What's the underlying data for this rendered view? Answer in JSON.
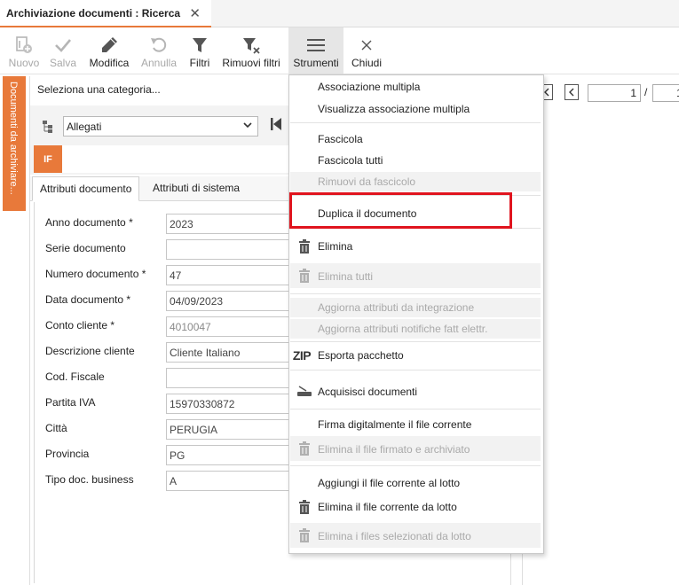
{
  "tab": {
    "title": "Archiviazione documenti : Ricerca",
    "close": "✕"
  },
  "toolbar": {
    "nuovo": "Nuovo",
    "salva": "Salva",
    "modifica": "Modifica",
    "annulla": "Annulla",
    "filtri": "Filtri",
    "rimuovi_filtri": "Rimuovi filtri",
    "strumenti": "Strumenti",
    "chiudi": "Chiudi"
  },
  "side_tab": "Documenti da archiviare...",
  "category": {
    "prompt": "Seleziona una categoria...",
    "selected": "Allegati",
    "badge": "IF"
  },
  "attribute_tabs": [
    "Attributi documento",
    "Attributi di sistema"
  ],
  "fields": [
    {
      "label": "Anno documento *",
      "value": "2023",
      "readonly": false
    },
    {
      "label": "Serie documento",
      "value": "",
      "readonly": false
    },
    {
      "label": "Numero documento *",
      "value": "47",
      "readonly": false
    },
    {
      "label": "Data documento *",
      "value": "04/09/2023",
      "readonly": false
    },
    {
      "label": "Conto cliente *",
      "value": "4010047",
      "readonly": true
    },
    {
      "label": "Descrizione cliente",
      "value": "Cliente Italiano",
      "readonly": false
    },
    {
      "label": "Cod. Fiscale",
      "value": "",
      "readonly": false
    },
    {
      "label": "Partita IVA",
      "value": "15970330872",
      "readonly": false
    },
    {
      "label": "Città",
      "value": "PERUGIA",
      "readonly": false
    },
    {
      "label": "Provincia",
      "value": "PG",
      "readonly": false
    },
    {
      "label": "Tipo doc. business",
      "value": "A",
      "readonly": false
    }
  ],
  "viewer": {
    "page": "1",
    "separator": "/",
    "total": "1"
  },
  "menu": {
    "associazione_multipla": "Associazione multipla",
    "visualizza_associazione": "Visualizza associazione multipla",
    "fascicola": "Fascicola",
    "fascicola_tutti": "Fascicola tutti",
    "rimuovi_fascicolo": "Rimuovi da fascicolo",
    "duplica": "Duplica il documento",
    "elimina": "Elimina",
    "elimina_tutti": "Elimina tutti",
    "aggiorna_integrazione": "Aggiorna attributi da integrazione",
    "aggiorna_notifiche": "Aggiorna attributi notifiche fatt elettr.",
    "zip_icon_text": "ZIP",
    "esporta": "Esporta pacchetto",
    "acquisisci": "Acquisisci documenti",
    "firma": "Firma digitalmente il file corrente",
    "elimina_firmato": "Elimina il file firmato e archiviato",
    "aggiungi_lotto": "Aggiungi il file corrente al lotto",
    "elimina_lotto": "Elimina il file corrente da lotto",
    "elimina_selezionati": "Elimina i files selezionati da lotto"
  },
  "colors": {
    "accent": "#e8793a",
    "highlight": "#e0141e"
  }
}
